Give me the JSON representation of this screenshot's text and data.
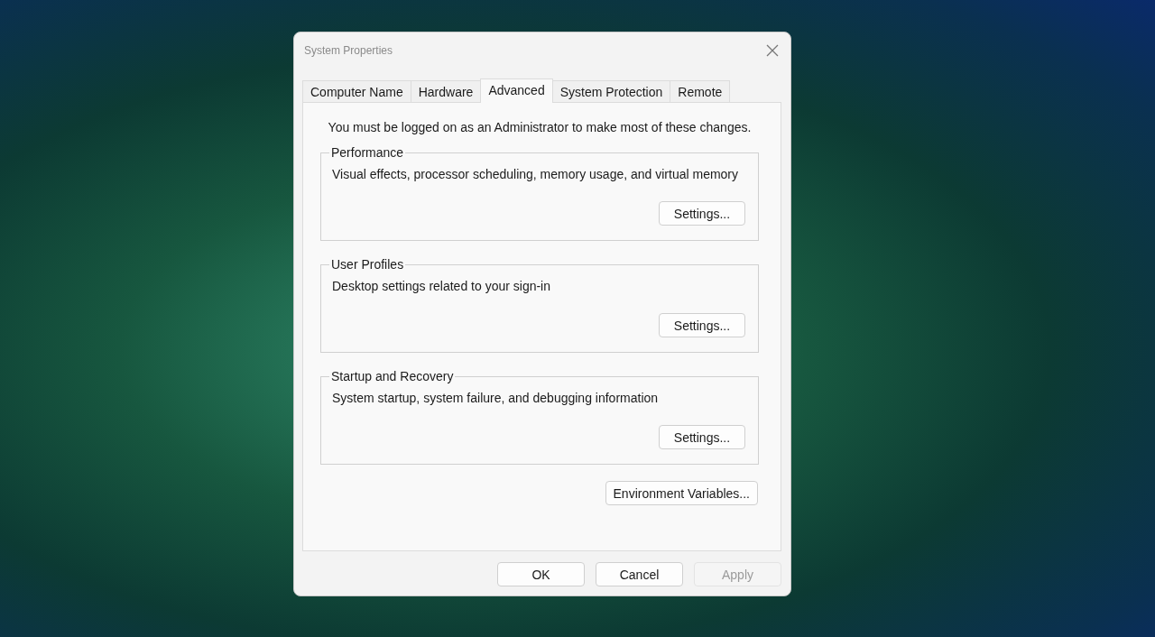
{
  "window": {
    "title": "System Properties"
  },
  "tabs": [
    {
      "label": "Computer Name",
      "selected": false
    },
    {
      "label": "Hardware",
      "selected": false
    },
    {
      "label": "Advanced",
      "selected": true
    },
    {
      "label": "System Protection",
      "selected": false
    },
    {
      "label": "Remote",
      "selected": false
    }
  ],
  "notice": "You must be logged on as an Administrator to make most of these changes.",
  "groups": [
    {
      "title": "Performance",
      "description": "Visual effects, processor scheduling, memory usage, and virtual memory",
      "button": "Settings..."
    },
    {
      "title": "User Profiles",
      "description": "Desktop settings related to your sign-in",
      "button": "Settings..."
    },
    {
      "title": "Startup and Recovery",
      "description": "System startup, system failure, and debugging information",
      "button": "Settings..."
    }
  ],
  "environment_button": "Environment Variables...",
  "buttons": [
    {
      "label": "OK",
      "disabled": false
    },
    {
      "label": "Cancel",
      "disabled": false
    },
    {
      "label": "Apply",
      "disabled": true
    }
  ]
}
